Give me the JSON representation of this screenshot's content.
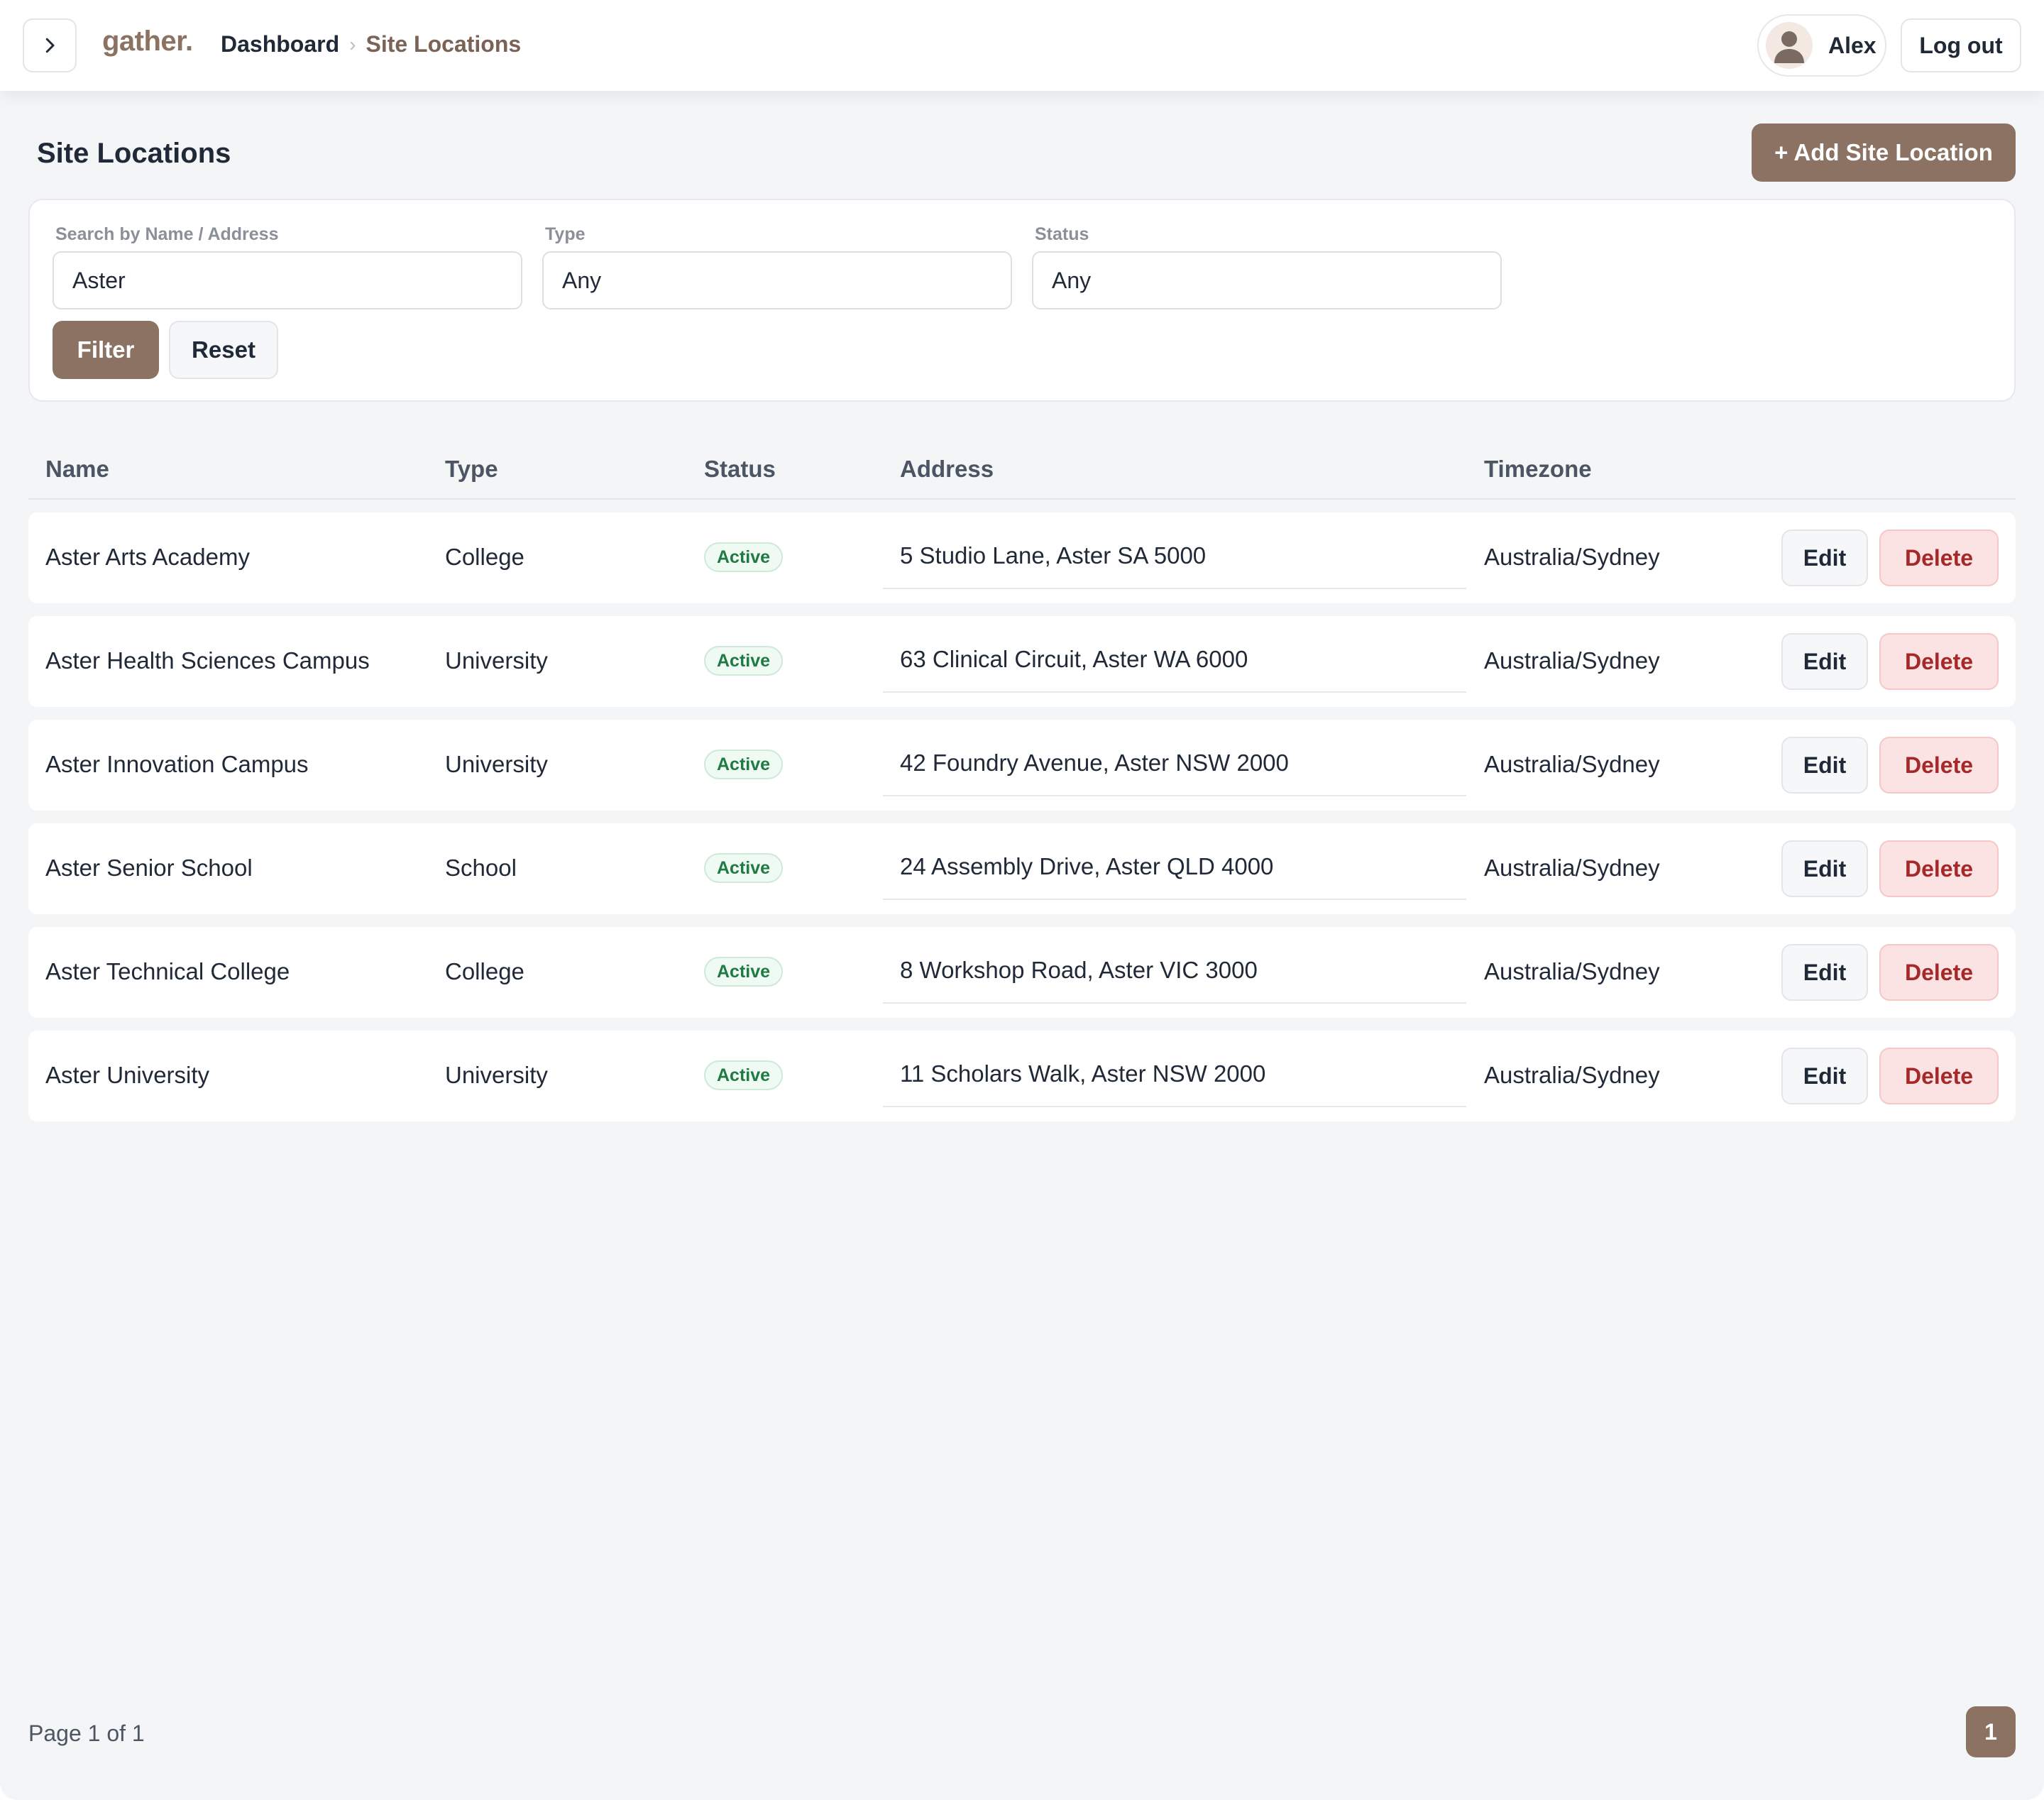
{
  "header": {
    "logo": "gather.",
    "breadcrumb": {
      "home": "Dashboard",
      "separator": "›",
      "current": "Site Locations"
    },
    "user": {
      "name": "Alex"
    },
    "logout_label": "Log out"
  },
  "page": {
    "title": "Site Locations",
    "add_button_label": "+ Add Site Location"
  },
  "filters": {
    "search": {
      "label": "Search by Name / Address",
      "value": "Aster"
    },
    "type": {
      "label": "Type",
      "value": "Any"
    },
    "status": {
      "label": "Status",
      "value": "Any"
    },
    "filter_label": "Filter",
    "reset_label": "Reset"
  },
  "table": {
    "columns": [
      "Name",
      "Type",
      "Status",
      "Address",
      "Timezone"
    ],
    "edit_label": "Edit",
    "delete_label": "Delete",
    "rows": [
      {
        "name": "Aster Arts Academy",
        "type": "College",
        "status": "Active",
        "address": "5 Studio Lane, Aster SA 5000",
        "timezone": "Australia/Sydney"
      },
      {
        "name": "Aster Health Sciences Campus",
        "type": "University",
        "status": "Active",
        "address": "63 Clinical Circuit, Aster WA 6000",
        "timezone": "Australia/Sydney"
      },
      {
        "name": "Aster Innovation Campus",
        "type": "University",
        "status": "Active",
        "address": "42 Foundry Avenue, Aster NSW 2000",
        "timezone": "Australia/Sydney"
      },
      {
        "name": "Aster Senior School",
        "type": "School",
        "status": "Active",
        "address": "24 Assembly Drive, Aster QLD 4000",
        "timezone": "Australia/Sydney"
      },
      {
        "name": "Aster Technical College",
        "type": "College",
        "status": "Active",
        "address": "8 Workshop Road, Aster VIC 3000",
        "timezone": "Australia/Sydney"
      },
      {
        "name": "Aster University",
        "type": "University",
        "status": "Active",
        "address": "11 Scholars Walk, Aster NSW 2000",
        "timezone": "Australia/Sydney"
      }
    ]
  },
  "pagination": {
    "info": "Page 1 of 1",
    "current_page": "1"
  },
  "colors": {
    "accent": "#8b7262",
    "status_active": "#1f7a43",
    "danger": "#a62828"
  }
}
